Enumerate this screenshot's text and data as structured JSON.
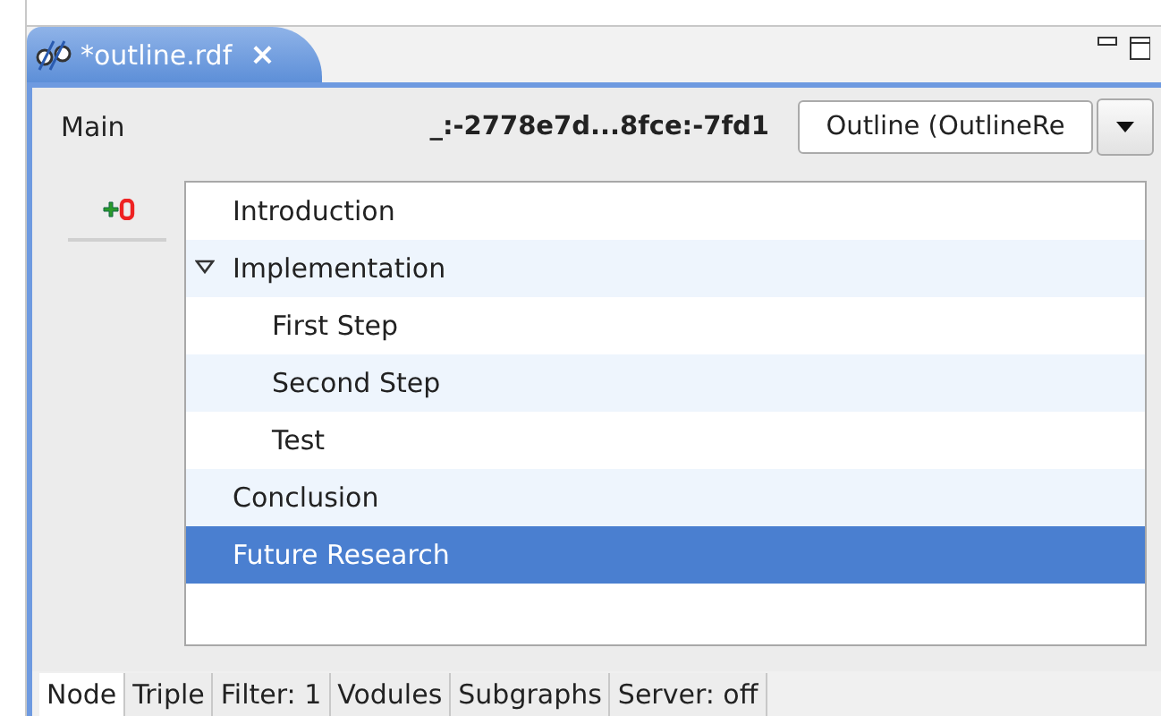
{
  "editor_tab": {
    "title": "*outline.rdf",
    "close": "×"
  },
  "header": {
    "label": "Main",
    "node_id": "_:-2778e7d...8fce:-7fd1",
    "view_select": {
      "value": "Outline (OutlineRe"
    }
  },
  "outline": [
    {
      "label": "Introduction",
      "selected": false
    },
    {
      "label": "Implementation",
      "selected": false,
      "expanded": true,
      "children": [
        {
          "label": "First Step",
          "selected": false
        },
        {
          "label": "Second Step",
          "selected": false
        },
        {
          "label": "Test",
          "selected": false
        }
      ]
    },
    {
      "label": "Conclusion",
      "selected": false
    },
    {
      "label": "Future Research",
      "selected": true
    }
  ],
  "bottom_tabs": [
    {
      "label": "Node",
      "selected": true
    },
    {
      "label": "Triple",
      "selected": false
    },
    {
      "label": "Filter: 1",
      "selected": false
    },
    {
      "label": "Vodules",
      "selected": false
    },
    {
      "label": "Subgraphs",
      "selected": false
    },
    {
      "label": "Server: off",
      "selected": false
    }
  ]
}
